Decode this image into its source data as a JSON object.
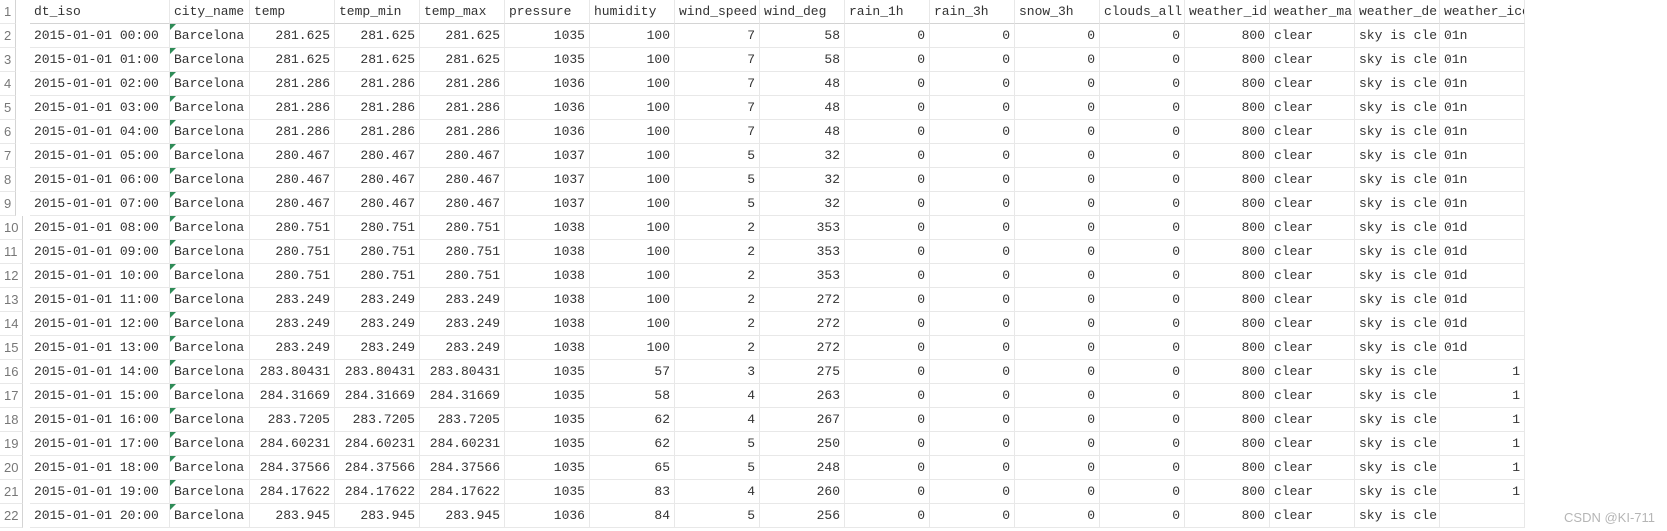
{
  "watermark": "CSDN @KI-711",
  "columns": [
    {
      "key": "dt_iso",
      "label": "dt_iso",
      "align": "txt",
      "mark": false
    },
    {
      "key": "city_name",
      "label": "city_name",
      "align": "txt",
      "mark": true
    },
    {
      "key": "temp",
      "label": "temp",
      "align": "num",
      "mark": false
    },
    {
      "key": "temp_min",
      "label": "temp_min",
      "align": "num",
      "mark": false
    },
    {
      "key": "temp_max",
      "label": "temp_max",
      "align": "num",
      "mark": false
    },
    {
      "key": "pressure",
      "label": "pressure",
      "align": "num",
      "mark": false
    },
    {
      "key": "humidity",
      "label": "humidity",
      "align": "num",
      "mark": false
    },
    {
      "key": "wind_speed",
      "label": "wind_speed",
      "align": "num",
      "mark": false
    },
    {
      "key": "wind_deg",
      "label": "wind_deg",
      "align": "num",
      "mark": false
    },
    {
      "key": "rain_1h",
      "label": "rain_1h",
      "align": "num",
      "mark": false
    },
    {
      "key": "rain_3h",
      "label": "rain_3h",
      "align": "num",
      "mark": false
    },
    {
      "key": "snow_3h",
      "label": "snow_3h",
      "align": "num",
      "mark": false
    },
    {
      "key": "clouds_all",
      "label": "clouds_all",
      "align": "num",
      "mark": false
    },
    {
      "key": "weather_id",
      "label": "weather_id",
      "align": "num",
      "mark": false
    },
    {
      "key": "weather_main",
      "label": "weather_ma",
      "align": "txt",
      "mark": false
    },
    {
      "key": "weather_desc",
      "label": "weather_de",
      "align": "txt",
      "mark": false
    },
    {
      "key": "weather_icon",
      "label": "weather_icon",
      "align": "txt",
      "mark": false
    }
  ],
  "row_numbers": [
    1,
    2,
    3,
    4,
    5,
    6,
    7,
    8,
    9,
    10,
    11,
    12,
    13,
    14,
    15,
    16,
    17,
    18,
    19,
    20,
    21,
    22
  ],
  "rows": [
    {
      "dt_iso": "2015-01-01 00:00",
      "city_name": "Barcelona",
      "temp": "281.625",
      "temp_min": "281.625",
      "temp_max": "281.625",
      "pressure": "1035",
      "humidity": "100",
      "wind_speed": "7",
      "wind_deg": "58",
      "rain_1h": "0",
      "rain_3h": "0",
      "snow_3h": "0",
      "clouds_all": "0",
      "weather_id": "800",
      "weather_main": "clear",
      "weather_desc": "sky is cle",
      "weather_icon": "01n"
    },
    {
      "dt_iso": "2015-01-01 01:00",
      "city_name": "Barcelona",
      "temp": "281.625",
      "temp_min": "281.625",
      "temp_max": "281.625",
      "pressure": "1035",
      "humidity": "100",
      "wind_speed": "7",
      "wind_deg": "58",
      "rain_1h": "0",
      "rain_3h": "0",
      "snow_3h": "0",
      "clouds_all": "0",
      "weather_id": "800",
      "weather_main": "clear",
      "weather_desc": "sky is cle",
      "weather_icon": "01n"
    },
    {
      "dt_iso": "2015-01-01 02:00",
      "city_name": "Barcelona",
      "temp": "281.286",
      "temp_min": "281.286",
      "temp_max": "281.286",
      "pressure": "1036",
      "humidity": "100",
      "wind_speed": "7",
      "wind_deg": "48",
      "rain_1h": "0",
      "rain_3h": "0",
      "snow_3h": "0",
      "clouds_all": "0",
      "weather_id": "800",
      "weather_main": "clear",
      "weather_desc": "sky is cle",
      "weather_icon": "01n"
    },
    {
      "dt_iso": "2015-01-01 03:00",
      "city_name": "Barcelona",
      "temp": "281.286",
      "temp_min": "281.286",
      "temp_max": "281.286",
      "pressure": "1036",
      "humidity": "100",
      "wind_speed": "7",
      "wind_deg": "48",
      "rain_1h": "0",
      "rain_3h": "0",
      "snow_3h": "0",
      "clouds_all": "0",
      "weather_id": "800",
      "weather_main": "clear",
      "weather_desc": "sky is cle",
      "weather_icon": "01n"
    },
    {
      "dt_iso": "2015-01-01 04:00",
      "city_name": "Barcelona",
      "temp": "281.286",
      "temp_min": "281.286",
      "temp_max": "281.286",
      "pressure": "1036",
      "humidity": "100",
      "wind_speed": "7",
      "wind_deg": "48",
      "rain_1h": "0",
      "rain_3h": "0",
      "snow_3h": "0",
      "clouds_all": "0",
      "weather_id": "800",
      "weather_main": "clear",
      "weather_desc": "sky is cle",
      "weather_icon": "01n"
    },
    {
      "dt_iso": "2015-01-01 05:00",
      "city_name": "Barcelona",
      "temp": "280.467",
      "temp_min": "280.467",
      "temp_max": "280.467",
      "pressure": "1037",
      "humidity": "100",
      "wind_speed": "5",
      "wind_deg": "32",
      "rain_1h": "0",
      "rain_3h": "0",
      "snow_3h": "0",
      "clouds_all": "0",
      "weather_id": "800",
      "weather_main": "clear",
      "weather_desc": "sky is cle",
      "weather_icon": "01n"
    },
    {
      "dt_iso": "2015-01-01 06:00",
      "city_name": "Barcelona",
      "temp": "280.467",
      "temp_min": "280.467",
      "temp_max": "280.467",
      "pressure": "1037",
      "humidity": "100",
      "wind_speed": "5",
      "wind_deg": "32",
      "rain_1h": "0",
      "rain_3h": "0",
      "snow_3h": "0",
      "clouds_all": "0",
      "weather_id": "800",
      "weather_main": "clear",
      "weather_desc": "sky is cle",
      "weather_icon": "01n"
    },
    {
      "dt_iso": "2015-01-01 07:00",
      "city_name": "Barcelona",
      "temp": "280.467",
      "temp_min": "280.467",
      "temp_max": "280.467",
      "pressure": "1037",
      "humidity": "100",
      "wind_speed": "5",
      "wind_deg": "32",
      "rain_1h": "0",
      "rain_3h": "0",
      "snow_3h": "0",
      "clouds_all": "0",
      "weather_id": "800",
      "weather_main": "clear",
      "weather_desc": "sky is cle",
      "weather_icon": "01n"
    },
    {
      "dt_iso": "2015-01-01 08:00",
      "city_name": "Barcelona",
      "temp": "280.751",
      "temp_min": "280.751",
      "temp_max": "280.751",
      "pressure": "1038",
      "humidity": "100",
      "wind_speed": "2",
      "wind_deg": "353",
      "rain_1h": "0",
      "rain_3h": "0",
      "snow_3h": "0",
      "clouds_all": "0",
      "weather_id": "800",
      "weather_main": "clear",
      "weather_desc": "sky is cle",
      "weather_icon": "01d"
    },
    {
      "dt_iso": "2015-01-01 09:00",
      "city_name": "Barcelona",
      "temp": "280.751",
      "temp_min": "280.751",
      "temp_max": "280.751",
      "pressure": "1038",
      "humidity": "100",
      "wind_speed": "2",
      "wind_deg": "353",
      "rain_1h": "0",
      "rain_3h": "0",
      "snow_3h": "0",
      "clouds_all": "0",
      "weather_id": "800",
      "weather_main": "clear",
      "weather_desc": "sky is cle",
      "weather_icon": "01d"
    },
    {
      "dt_iso": "2015-01-01 10:00",
      "city_name": "Barcelona",
      "temp": "280.751",
      "temp_min": "280.751",
      "temp_max": "280.751",
      "pressure": "1038",
      "humidity": "100",
      "wind_speed": "2",
      "wind_deg": "353",
      "rain_1h": "0",
      "rain_3h": "0",
      "snow_3h": "0",
      "clouds_all": "0",
      "weather_id": "800",
      "weather_main": "clear",
      "weather_desc": "sky is cle",
      "weather_icon": "01d"
    },
    {
      "dt_iso": "2015-01-01 11:00",
      "city_name": "Barcelona",
      "temp": "283.249",
      "temp_min": "283.249",
      "temp_max": "283.249",
      "pressure": "1038",
      "humidity": "100",
      "wind_speed": "2",
      "wind_deg": "272",
      "rain_1h": "0",
      "rain_3h": "0",
      "snow_3h": "0",
      "clouds_all": "0",
      "weather_id": "800",
      "weather_main": "clear",
      "weather_desc": "sky is cle",
      "weather_icon": "01d"
    },
    {
      "dt_iso": "2015-01-01 12:00",
      "city_name": "Barcelona",
      "temp": "283.249",
      "temp_min": "283.249",
      "temp_max": "283.249",
      "pressure": "1038",
      "humidity": "100",
      "wind_speed": "2",
      "wind_deg": "272",
      "rain_1h": "0",
      "rain_3h": "0",
      "snow_3h": "0",
      "clouds_all": "0",
      "weather_id": "800",
      "weather_main": "clear",
      "weather_desc": "sky is cle",
      "weather_icon": "01d"
    },
    {
      "dt_iso": "2015-01-01 13:00",
      "city_name": "Barcelona",
      "temp": "283.249",
      "temp_min": "283.249",
      "temp_max": "283.249",
      "pressure": "1038",
      "humidity": "100",
      "wind_speed": "2",
      "wind_deg": "272",
      "rain_1h": "0",
      "rain_3h": "0",
      "snow_3h": "0",
      "clouds_all": "0",
      "weather_id": "800",
      "weather_main": "clear",
      "weather_desc": "sky is cle",
      "weather_icon": "01d"
    },
    {
      "dt_iso": "2015-01-01 14:00",
      "city_name": "Barcelona",
      "temp": "283.80431",
      "temp_min": "283.80431",
      "temp_max": "283.80431",
      "pressure": "1035",
      "humidity": "57",
      "wind_speed": "3",
      "wind_deg": "275",
      "rain_1h": "0",
      "rain_3h": "0",
      "snow_3h": "0",
      "clouds_all": "0",
      "weather_id": "800",
      "weather_main": "clear",
      "weather_desc": "sky is cle",
      "weather_icon": "1"
    },
    {
      "dt_iso": "2015-01-01 15:00",
      "city_name": "Barcelona",
      "temp": "284.31669",
      "temp_min": "284.31669",
      "temp_max": "284.31669",
      "pressure": "1035",
      "humidity": "58",
      "wind_speed": "4",
      "wind_deg": "263",
      "rain_1h": "0",
      "rain_3h": "0",
      "snow_3h": "0",
      "clouds_all": "0",
      "weather_id": "800",
      "weather_main": "clear",
      "weather_desc": "sky is cle",
      "weather_icon": "1"
    },
    {
      "dt_iso": "2015-01-01 16:00",
      "city_name": "Barcelona",
      "temp": "283.7205",
      "temp_min": "283.7205",
      "temp_max": "283.7205",
      "pressure": "1035",
      "humidity": "62",
      "wind_speed": "4",
      "wind_deg": "267",
      "rain_1h": "0",
      "rain_3h": "0",
      "snow_3h": "0",
      "clouds_all": "0",
      "weather_id": "800",
      "weather_main": "clear",
      "weather_desc": "sky is cle",
      "weather_icon": "1"
    },
    {
      "dt_iso": "2015-01-01 17:00",
      "city_name": "Barcelona",
      "temp": "284.60231",
      "temp_min": "284.60231",
      "temp_max": "284.60231",
      "pressure": "1035",
      "humidity": "62",
      "wind_speed": "5",
      "wind_deg": "250",
      "rain_1h": "0",
      "rain_3h": "0",
      "snow_3h": "0",
      "clouds_all": "0",
      "weather_id": "800",
      "weather_main": "clear",
      "weather_desc": "sky is cle",
      "weather_icon": "1"
    },
    {
      "dt_iso": "2015-01-01 18:00",
      "city_name": "Barcelona",
      "temp": "284.37566",
      "temp_min": "284.37566",
      "temp_max": "284.37566",
      "pressure": "1035",
      "humidity": "65",
      "wind_speed": "5",
      "wind_deg": "248",
      "rain_1h": "0",
      "rain_3h": "0",
      "snow_3h": "0",
      "clouds_all": "0",
      "weather_id": "800",
      "weather_main": "clear",
      "weather_desc": "sky is cle",
      "weather_icon": "1"
    },
    {
      "dt_iso": "2015-01-01 19:00",
      "city_name": "Barcelona",
      "temp": "284.17622",
      "temp_min": "284.17622",
      "temp_max": "284.17622",
      "pressure": "1035",
      "humidity": "83",
      "wind_speed": "4",
      "wind_deg": "260",
      "rain_1h": "0",
      "rain_3h": "0",
      "snow_3h": "0",
      "clouds_all": "0",
      "weather_id": "800",
      "weather_main": "clear",
      "weather_desc": "sky is cle",
      "weather_icon": "1"
    },
    {
      "dt_iso": "2015-01-01 20:00",
      "city_name": "Barcelona",
      "temp": "283.945",
      "temp_min": "283.945",
      "temp_max": "283.945",
      "pressure": "1036",
      "humidity": "84",
      "wind_speed": "5",
      "wind_deg": "256",
      "rain_1h": "0",
      "rain_3h": "0",
      "snow_3h": "0",
      "clouds_all": "0",
      "weather_id": "800",
      "weather_main": "clear",
      "weather_desc": "sky is cle",
      "weather_icon": ""
    }
  ],
  "icon_align_num_rows": [
    14,
    15,
    16,
    17,
    18,
    19
  ]
}
